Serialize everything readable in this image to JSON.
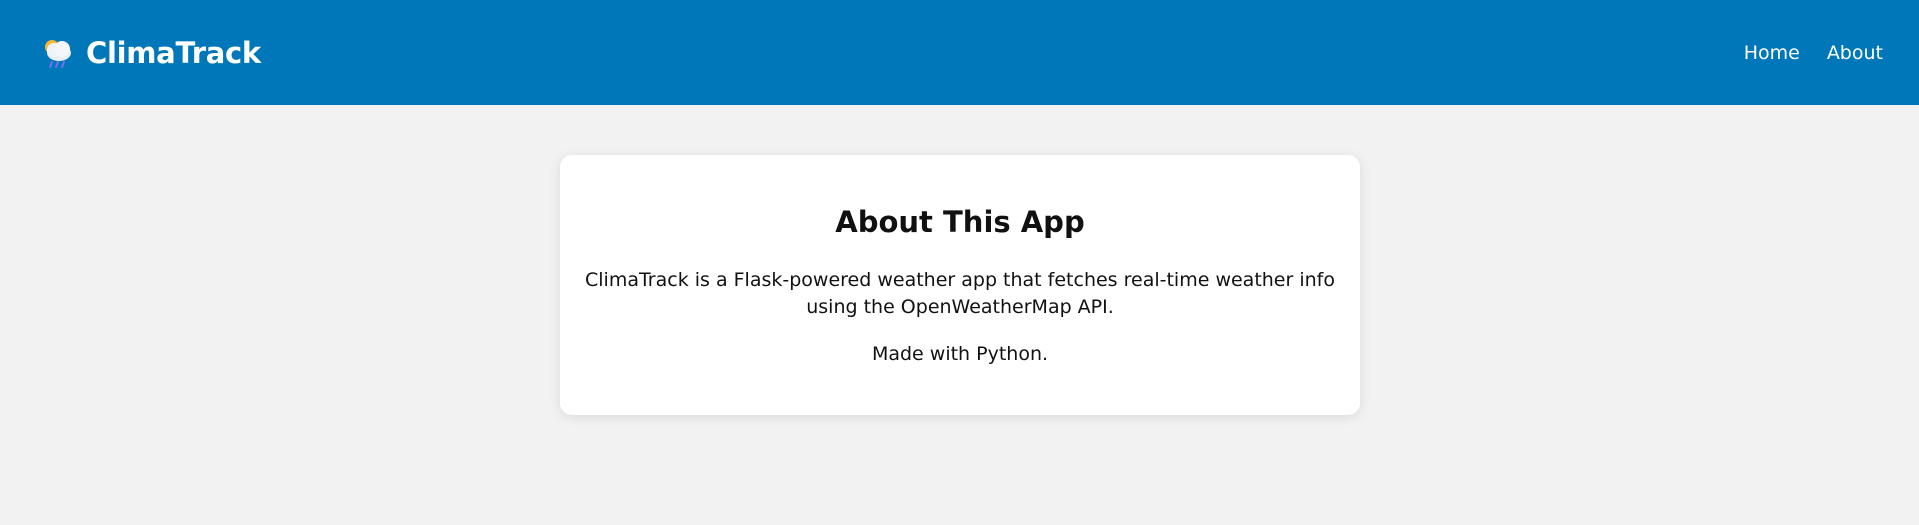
{
  "navbar": {
    "brand_icon": "cloud-sun-rain-icon",
    "brand_name": "ClimaTrack",
    "links": [
      {
        "label": "Home"
      },
      {
        "label": "About"
      }
    ],
    "background_color": "#0077b8"
  },
  "about": {
    "title": "About This App",
    "description": "ClimaTrack is a Flask-powered weather app that fetches real-time weather info using the OpenWeatherMap API.",
    "credit": "Made with Python."
  }
}
